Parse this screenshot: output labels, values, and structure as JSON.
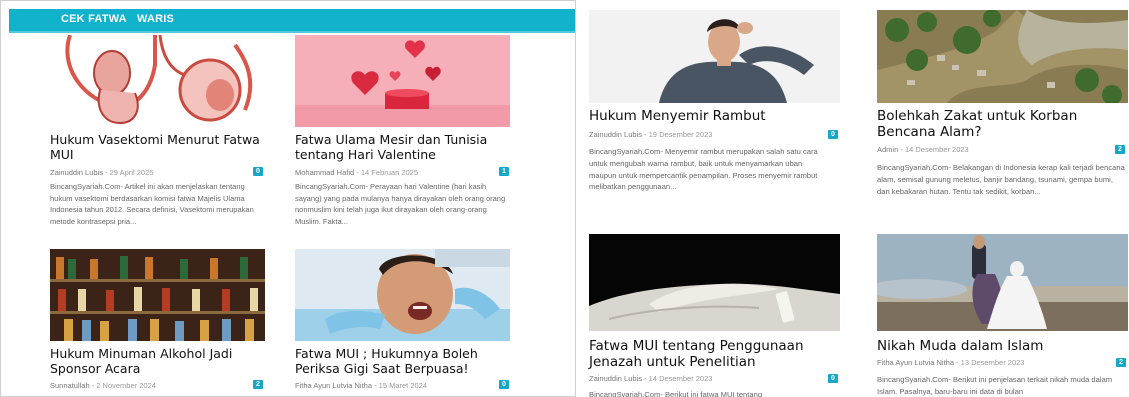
{
  "nav": {
    "items": [
      "CEK FATWA",
      "WARIS"
    ]
  },
  "colors": {
    "accent": "#11b3cc",
    "badge": "#16a8c9"
  },
  "left_posts": [
    {
      "title": "Hukum Vasektomi Menurut Fatwa MUI",
      "author": "Zainuddin Lubis",
      "date": "29 April 2025",
      "comments": "0",
      "excerpt": "BincangSyariah.Com- Artikel ini akan menjelaskan tentang hukum vasektomi berdasarkan komisi fatwa Majelis Ulama Indonesia tahun 2012. Secara definisi, Vasektomi merupakan metode kontrasepsi pria...",
      "image": "anatomy-illustration"
    },
    {
      "title": "Fatwa Ulama Mesir dan Tunisia tentang Hari Valentine",
      "author": "Mohammad Hafid",
      "date": "14 Februari 2025",
      "comments": "1",
      "excerpt": "BincangSyariah.Com- Perayaan hari Valentine (hari kasih sayang) yang pada mulanya hanya dirayakan oleh orang orang nonmuslim kini telah juga ikut dirayakan oleh orang-orang Muslim. Fakta...",
      "image": "valentine-hearts"
    },
    {
      "title": "Hukum Minuman Alkohol Jadi Sponsor Acara",
      "author": "Sunnatullah",
      "date": "2 November 2024",
      "comments": "2",
      "image": "liquor-shelf"
    },
    {
      "title": "Fatwa MUI ; Hukumnya Boleh Periksa Gigi Saat Berpuasa!",
      "author": "Fitha Ayun Lutvia Nitha",
      "date": "15 Maret 2024",
      "comments": "0",
      "image": "dental-checkup"
    }
  ],
  "right_posts": [
    {
      "title": "Hukum Menyemir Rambut",
      "author": "Zainuddin Lubis",
      "date": "19 Desember 2023",
      "comments": "0",
      "excerpt": "BincangSyariah.Com- Menyemir rambut merupakan salah satu cara untuk mengubah warna rambut, baik untuk menyamarkan uban maupun untuk mempercantik penampilan. Proses menyemir rambut melibatkan penggunaan...",
      "image": "man-touching-hair"
    },
    {
      "title": "Bolehkah Zakat untuk Korban Bencana Alam?",
      "author": "Admin",
      "date": "14 Desember 2023",
      "comments": "2",
      "excerpt": "BincangSyariah.Com- Belakangan di Indonesia kerap kali terjadi bencana alam, semisal gunung meletus, banjir bandang, tsunami, gempa bumi, dan kebakaran hutan. Tentu tak sedikit, korban...",
      "image": "flood-aerial"
    },
    {
      "title": "Fatwa MUI tentang Penggunaan Jenazah untuk Penelitian",
      "author": "Zainuddin Lubis",
      "date": "14 Desember 2023",
      "comments": "0",
      "excerpt": "BincangSyariah.Com- Berikut ini fatwa MUI tentang",
      "image": "covered-body"
    },
    {
      "title": "Nikah Muda dalam Islam",
      "author": "Fitha Ayun Lutvia Nitha",
      "date": "13 Desember 2023",
      "comments": "2",
      "excerpt": "BincangSyariah.Com- Berikut ini penjelasan terkait nikah muda dalam Islam. Pasalnya, baru-baru ini data di bulan",
      "image": "wedding-couple"
    }
  ]
}
